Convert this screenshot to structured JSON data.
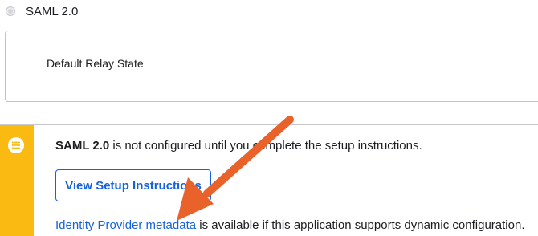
{
  "saml_option": {
    "label": "SAML 2.0"
  },
  "relay_state": {
    "label": "Default Relay State"
  },
  "notice": {
    "icon": "list-icon",
    "accent_color": "#fbba12",
    "bold_text": "SAML 2.0",
    "message": " is not configured until you complete the setup instructions.",
    "button_label": "View Setup Instructions",
    "metadata_link": "Identity Provider metadata",
    "metadata_suffix": " is available if this application supports dynamic configuration."
  },
  "annotation": {
    "arrow_color": "#e8622a"
  }
}
